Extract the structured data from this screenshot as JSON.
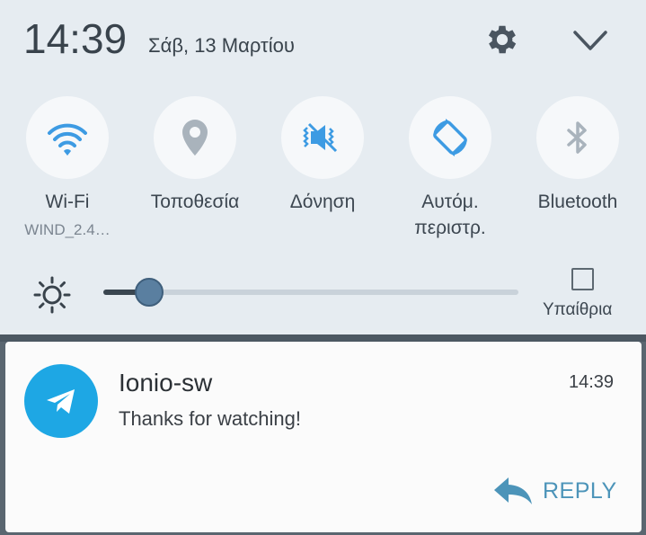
{
  "status": {
    "time": "14:39",
    "date": "Σάβ, 13 Μαρτίου"
  },
  "quick_settings": [
    {
      "label": "Wi-Fi",
      "sublabel": "WIND_2.4…",
      "icon": "wifi-icon"
    },
    {
      "label": "Τοποθεσία",
      "icon": "location-icon"
    },
    {
      "label": "Δόνηση",
      "icon": "vibrate-icon"
    },
    {
      "label": "Αυτόμ.\nπεριστρ.",
      "label_line1": "Αυτόμ.",
      "label_line2": "περιστρ.",
      "icon": "auto-rotate-icon"
    },
    {
      "label": "Bluetooth",
      "icon": "bluetooth-icon"
    }
  ],
  "brightness": {
    "level": 0.11,
    "outdoor_label": "Υπαίθρια",
    "outdoor_checked": false
  },
  "notification": {
    "app_icon": "telegram-icon",
    "title": "Ionio-sw",
    "text": "Thanks for watching!",
    "time": "14:39",
    "reply_label": "REPLY"
  },
  "colors": {
    "accent": "#4c94b9",
    "icon_blue": "#3d9be3",
    "telegram": "#1ea7e4",
    "panel_bg": "#e6ecf1"
  }
}
